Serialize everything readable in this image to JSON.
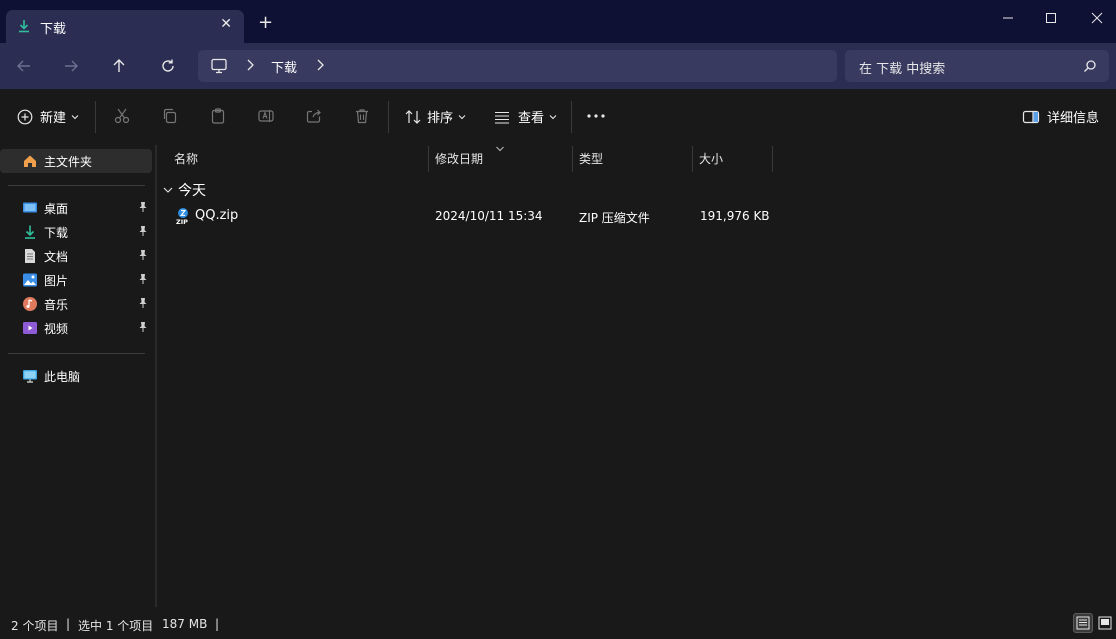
{
  "tab": {
    "title": "下载",
    "close": "✕",
    "new_tab": "+"
  },
  "window_controls": {
    "minimize": "—",
    "maximize": "☐",
    "close": "✕"
  },
  "address": {
    "breadcrumb": "下载"
  },
  "search": {
    "placeholder": "在 下载 中搜索"
  },
  "toolbar": {
    "new_label": "新建",
    "sort_label": "排序",
    "view_label": "查看",
    "details_label": "详细信息"
  },
  "sidebar": {
    "home": "主文件夹",
    "pinned": [
      {
        "label": "桌面",
        "icon": "desktop-icon",
        "color": "#3a8ee6"
      },
      {
        "label": "下载",
        "icon": "download-icon",
        "color": "#2fbf9c"
      },
      {
        "label": "文档",
        "icon": "document-icon",
        "color": "#a0a0a0"
      },
      {
        "label": "图片",
        "icon": "pictures-icon",
        "color": "#3a8ee6"
      },
      {
        "label": "音乐",
        "icon": "music-icon",
        "color": "#e07a5f"
      },
      {
        "label": "视频",
        "icon": "video-icon",
        "color": "#8e5bd6"
      }
    ],
    "this_pc": "此电脑"
  },
  "columns": {
    "name": "名称",
    "modified": "修改日期",
    "type": "类型",
    "size": "大小"
  },
  "groups": [
    {
      "label": "今天",
      "files": [
        {
          "name": "QQ.zip",
          "modified": "2024/10/11 15:34",
          "type": "ZIP 压缩文件",
          "size": "191,976 KB"
        }
      ]
    }
  ],
  "status": {
    "item_count": "2 个项目",
    "sep": "|",
    "selected": "选中 1 个项目",
    "selected_size": "187 MB"
  },
  "colors": {
    "title_bar": "#0f1134",
    "nav_bar": "#2b2d52",
    "background": "#191919",
    "accent": "#2fbf9c"
  }
}
